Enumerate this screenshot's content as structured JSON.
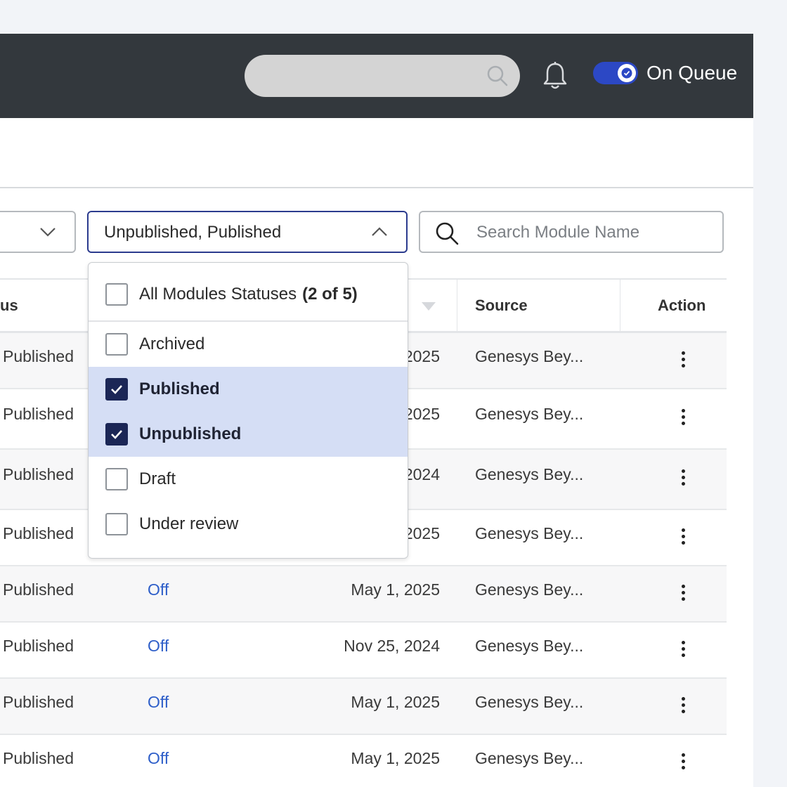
{
  "topbar": {
    "queue_label": "On Queue",
    "queue_toggle_on": true
  },
  "filters": {
    "status_value": "Unpublished, Published",
    "search_placeholder": "Search Module Name"
  },
  "table": {
    "headers": {
      "status": "us",
      "source": "Source",
      "action": "Action"
    },
    "rows": [
      {
        "status": "Published",
        "off": "",
        "date": "2025",
        "source": "Genesys Bey..."
      },
      {
        "status": "Published",
        "off": "",
        "date": "2025",
        "source": "Genesys Bey..."
      },
      {
        "status": "Published",
        "off": "",
        "date": "2024",
        "source": "Genesys Bey..."
      },
      {
        "status": "Published",
        "off": "",
        "date": "2025",
        "source": "Genesys Bey..."
      },
      {
        "status": "Published",
        "off": "Off",
        "date": "May 1, 2025",
        "source": "Genesys Bey..."
      },
      {
        "status": "Published",
        "off": "Off",
        "date": "Nov 25, 2024",
        "source": "Genesys Bey..."
      },
      {
        "status": "Published",
        "off": "Off",
        "date": "May 1, 2025",
        "source": "Genesys Bey..."
      },
      {
        "status": "Published",
        "off": "Off",
        "date": "May 1, 2025",
        "source": "Genesys Bey..."
      }
    ]
  },
  "dropdown": {
    "all_label": "All Modules Statuses",
    "all_count": "(2 of 5)",
    "options": [
      {
        "label": "Archived",
        "checked": false
      },
      {
        "label": "Published",
        "checked": true
      },
      {
        "label": "Unpublished",
        "checked": true
      },
      {
        "label": "Draft",
        "checked": false
      },
      {
        "label": "Under review",
        "checked": false
      }
    ]
  },
  "colors": {
    "topbar": "#33383d",
    "accent": "#2c48c5",
    "checked_bg": "#d5def5",
    "checkbox_on": "#1b2656",
    "link": "#2f5fc9"
  }
}
